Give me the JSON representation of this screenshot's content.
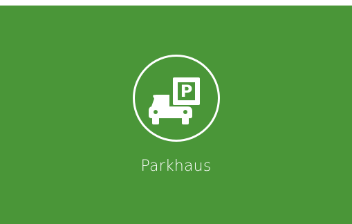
{
  "tile": {
    "label": "Parkhaus",
    "icon": "parking-garage-icon",
    "sign_letter": "P",
    "background_color": "#4a9638",
    "foreground_color": "#ffffff"
  }
}
